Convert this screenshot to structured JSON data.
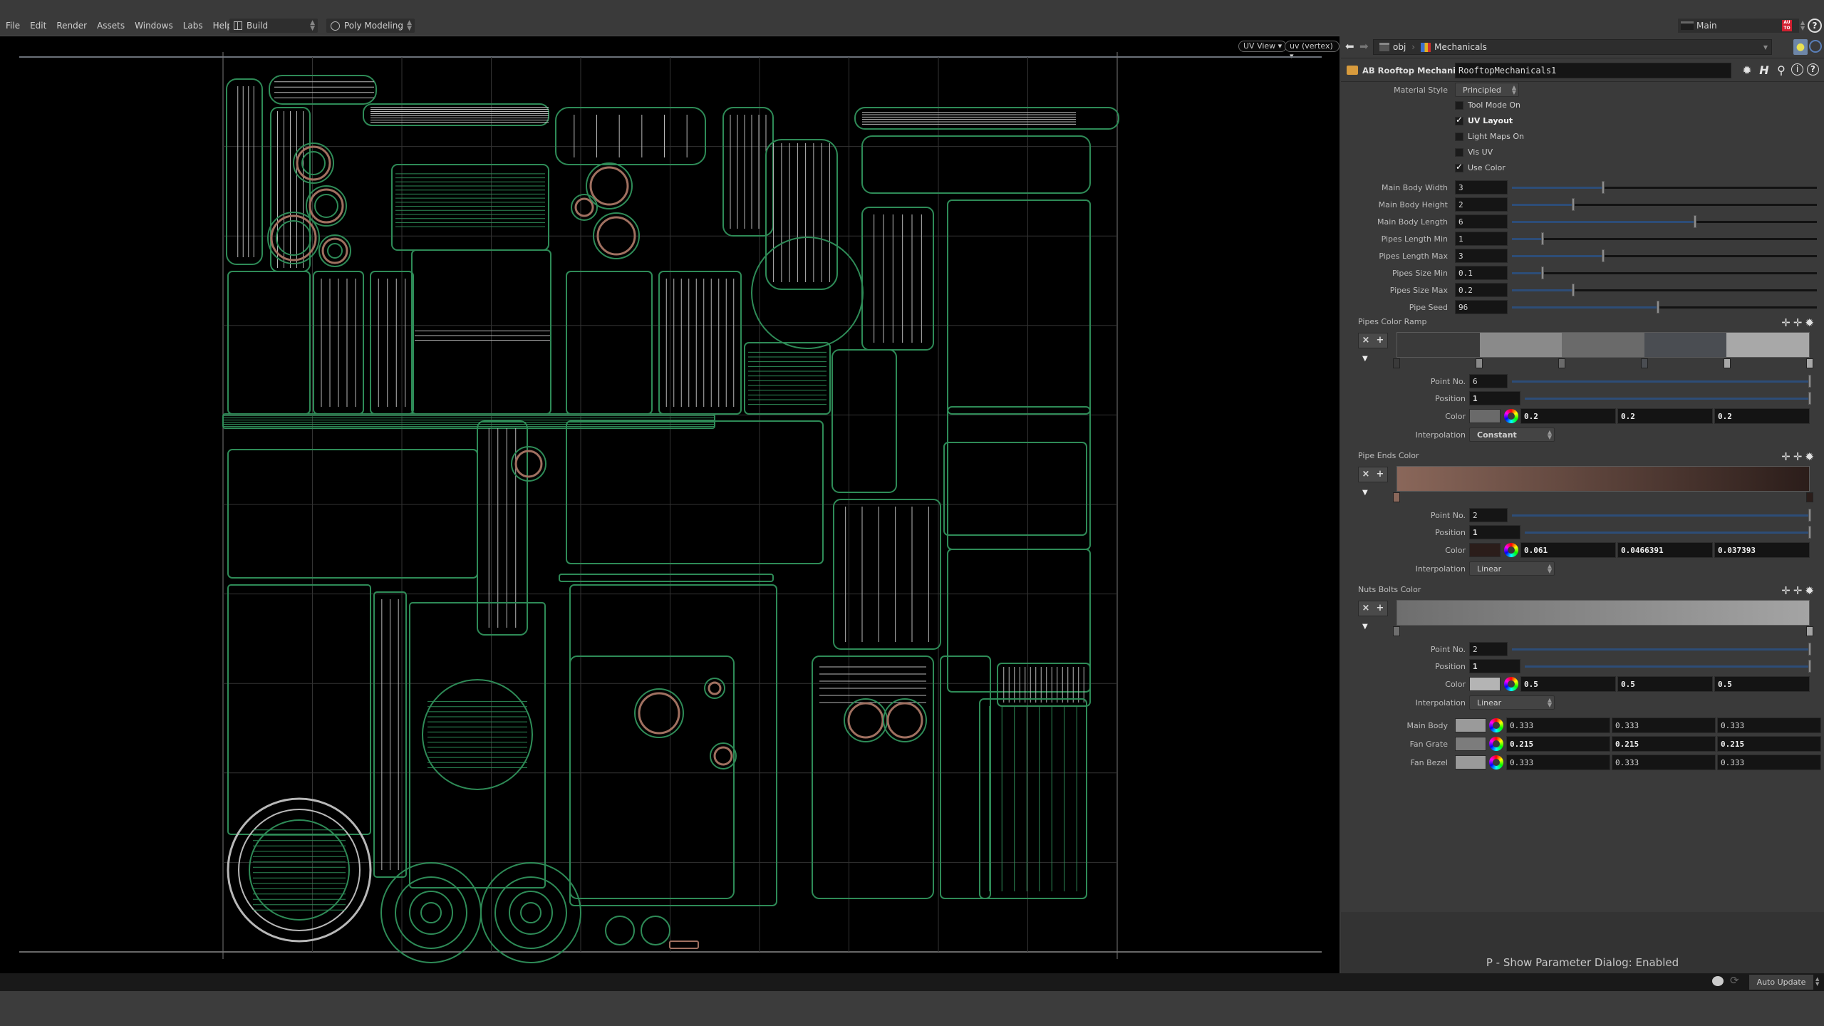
{
  "menubar": {
    "items": [
      "File",
      "Edit",
      "Render",
      "Assets",
      "Windows",
      "Labs",
      "Help"
    ],
    "desktop": "Build",
    "shelf": "Poly Modeling"
  },
  "top_right": {
    "context": "Main",
    "auto_badge": "AU TO",
    "help_icon": "?"
  },
  "viewport": {
    "view_menu": "UV View ▾",
    "attribute_menu": "uv (vertex) ▾",
    "wire_color": "#2e8b57",
    "inner_wire_color": "#b8b8b8",
    "accent_wire_color": "#a07060"
  },
  "pathbar": {
    "segments": [
      "obj",
      "Mechanicals"
    ]
  },
  "node": {
    "type_label": "AB Rooftop Mechanicals",
    "name": "RooftopMechanicals1"
  },
  "params": {
    "material_style": {
      "label": "Material Style",
      "value": "Principled"
    },
    "toggles": [
      {
        "label": "Tool Mode On",
        "checked": false
      },
      {
        "label": "UV Layout",
        "checked": true
      },
      {
        "label": "Light Maps On",
        "checked": false
      },
      {
        "label": "Vis UV",
        "checked": false
      },
      {
        "label": "Use Color",
        "checked": true
      }
    ],
    "sliders": [
      {
        "label": "Main Body Width",
        "value": "3",
        "fraction": 0.3
      },
      {
        "label": "Main Body Height",
        "value": "2",
        "fraction": 0.2
      },
      {
        "label": "Main Body Length",
        "value": "6",
        "fraction": 0.6
      },
      {
        "label": "Pipes Length Min",
        "value": "1",
        "fraction": 0.1
      },
      {
        "label": "Pipes Length Max",
        "value": "3",
        "fraction": 0.3
      },
      {
        "label": "Pipes Size Min",
        "value": "0.1",
        "fraction": 0.1
      },
      {
        "label": "Pipes Size Max",
        "value": "0.2",
        "fraction": 0.2
      },
      {
        "label": "Pipe Seed",
        "value": "96",
        "fraction": 0.48
      }
    ]
  },
  "ramps": [
    {
      "title": "Pipes Color Ramp",
      "point_no_label": "Point No.",
      "point_no": "6",
      "position_label": "Position",
      "position": "1",
      "color_label": "Color",
      "color": [
        "0.2",
        "0.2",
        "0.2"
      ],
      "swatch": "#6a6a6a",
      "interp_label": "Interpolation",
      "interpolation": "Constant",
      "segments": [
        "#3a3a3a",
        "#8a8a8a",
        "#6a6a6a",
        "#4a4d52",
        "#a8a8a8"
      ],
      "keys": [
        0,
        0.2,
        0.4,
        0.6,
        0.8,
        1.0
      ]
    },
    {
      "title": "Pipe Ends Color",
      "point_no_label": "Point No.",
      "point_no": "2",
      "position_label": "Position",
      "position": "1",
      "color_label": "Color",
      "color": [
        "0.061",
        "0.0466391",
        "0.037393"
      ],
      "swatch": "#2b1d1a",
      "interp_label": "Interpolation",
      "interpolation": "Linear",
      "gradient": [
        "#8a675a",
        "#2b1d1a"
      ],
      "keys": [
        0,
        1.0
      ]
    },
    {
      "title": "Nuts Bolts Color",
      "point_no_label": "Point No.",
      "point_no": "2",
      "position_label": "Position",
      "position": "1",
      "color_label": "Color",
      "color": [
        "0.5",
        "0.5",
        "0.5"
      ],
      "swatch": "#b4b4b4",
      "interp_label": "Interpolation",
      "interpolation": "Linear",
      "gradient": [
        "#6e6e6e",
        "#a4a4a4"
      ],
      "keys": [
        0,
        1.0
      ]
    }
  ],
  "colors": [
    {
      "label": "Main Body",
      "values": [
        "0.333",
        "0.333",
        "0.333"
      ],
      "swatch": "#9a9a9a",
      "bold": false
    },
    {
      "label": "Fan Grate",
      "values": [
        "0.215",
        "0.215",
        "0.215"
      ],
      "swatch": "#7c7c7c",
      "bold": true
    },
    {
      "label": "Fan Bezel",
      "values": [
        "0.333",
        "0.333",
        "0.333"
      ],
      "swatch": "#9a9a9a",
      "bold": false
    }
  ],
  "footer": {
    "message": "P - Show Parameter Dialog: Enabled",
    "auto_update": "Auto Update"
  }
}
